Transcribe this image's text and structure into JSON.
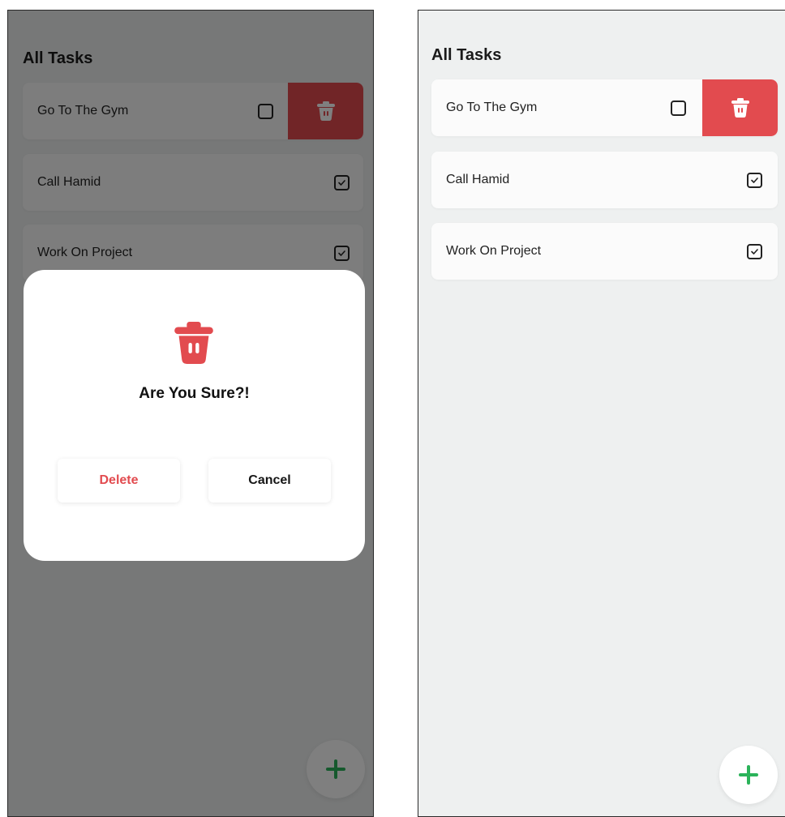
{
  "screens": {
    "left": {
      "title": "All Tasks",
      "tasks": [
        {
          "label": "Go To The Gym",
          "checked": false
        },
        {
          "label": "Call Hamid",
          "checked": true
        },
        {
          "label": "Work On Project",
          "checked": true
        }
      ],
      "dialog": {
        "title": "Are You Sure?!",
        "delete_label": "Delete",
        "cancel_label": "Cancel"
      }
    },
    "right": {
      "title": "All Tasks",
      "tasks": [
        {
          "label": "Go To The Gym",
          "checked": false
        },
        {
          "label": "Call Hamid",
          "checked": true
        },
        {
          "label": "Work On Project",
          "checked": true
        }
      ]
    }
  },
  "icons": {
    "delete": "trash-icon",
    "add": "plus-icon",
    "unchecked": "checkbox-empty-icon",
    "checked": "checkbox-checked-icon"
  },
  "colors": {
    "danger": "#e24b4f",
    "accent_green": "#2bb35a",
    "background": "#eef0f0",
    "card": "#fbfbfb"
  }
}
